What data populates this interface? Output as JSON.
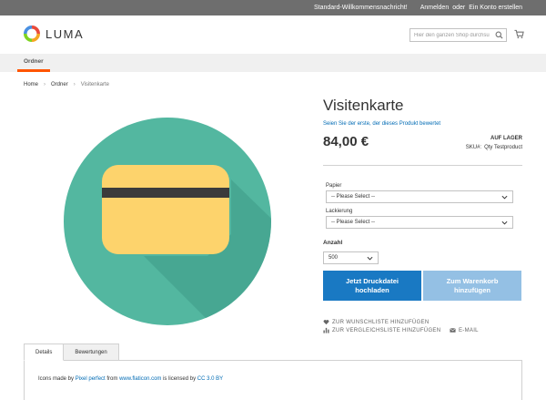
{
  "topbar": {
    "welcome": "Standard-Willkommensnachricht!",
    "login": "Anmelden",
    "or": "oder",
    "register": "Ein Konto erstellen"
  },
  "header": {
    "brand": "LUMA",
    "search_placeholder": "Hier den ganzen Shop durchsu"
  },
  "nav": {
    "items": [
      {
        "label": "Ordner"
      }
    ]
  },
  "breadcrumb": {
    "home": "Home",
    "category": "Ordner",
    "current": "Visitenkarte"
  },
  "product": {
    "title": "Visitenkarte",
    "review_link": "Seien Sie der erste, der dieses Produkt bewertet",
    "price": "84,00 €",
    "stock": "AUF LAGER",
    "sku_label": "SKU#:",
    "sku_value": "Qty Testproduct",
    "image_icon": "credit-card-icon",
    "colors": {
      "circle": "#53b7a0",
      "card": "#fdd36c",
      "stripe": "#3b3b3b",
      "shadow": "#3e9a86"
    }
  },
  "options": {
    "papier_label": "Papier",
    "papier_value": "-- Please Select --",
    "lackierung_label": "Lackierung",
    "lackierung_value": "-- Please Select --",
    "qty_label": "Anzahl",
    "qty_value": "500"
  },
  "buttons": {
    "upload_line1": "Jetzt Druckdatei",
    "upload_line2": "hochladen",
    "cart_line1": "Zum Warenkorb",
    "cart_line2": "hinzufügen"
  },
  "actions": {
    "wishlist": "ZUR WUNSCHLISTE HINZUFÜGEN",
    "compare": "ZUR VERGLEICHSLISTE HINZUFÜGEN",
    "email": "E-MAIL"
  },
  "tabs": {
    "details": "Details",
    "reviews": "Bewertungen"
  },
  "credits": {
    "t1": "Icons made by",
    "author": "Pixel perfect",
    "t2": "from",
    "site": "www.flaticon.com",
    "t3": "is licensed by",
    "license": "CC 3.0 BY"
  }
}
